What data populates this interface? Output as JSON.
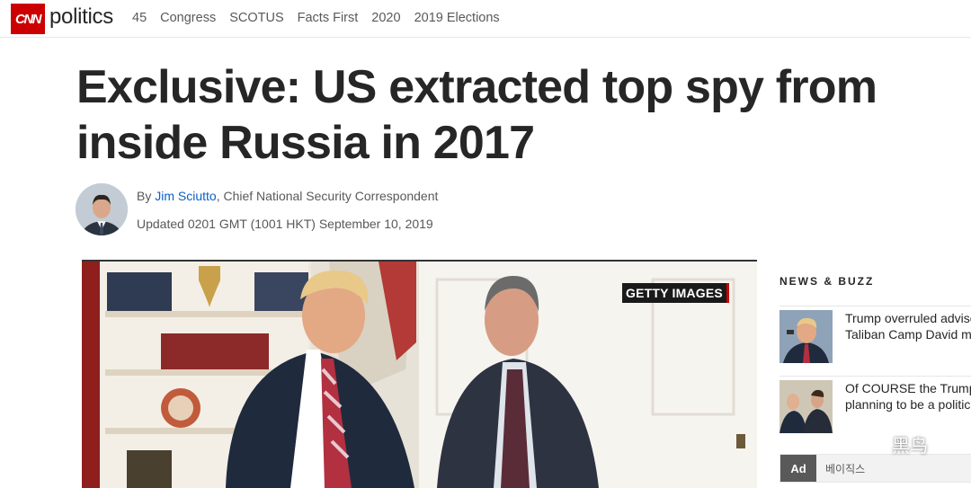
{
  "nav": {
    "logo": "CNN",
    "section": "politics",
    "links": [
      "45",
      "Congress",
      "SCOTUS",
      "Facts First",
      "2020",
      "2019 Elections"
    ]
  },
  "article": {
    "headline": "Exclusive: US extracted top spy from inside Russia in 2017",
    "byline_prefix": "By ",
    "author": "Jim Sciutto",
    "author_title": ", Chief National Security Correspondent",
    "updated": "Updated 0201 GMT (1001 HKT) September 10, 2019",
    "photo_credit": "GETTY IMAGES"
  },
  "sidebar": {
    "title": "NEWS & BUZZ",
    "items": [
      {
        "text_line1": "Trump overruled advise",
        "text_line2": "Taliban Camp David me"
      },
      {
        "text_line1": "Of COURSE the Trumps",
        "text_line2": "planning to be a politic"
      }
    ],
    "ad_label": "Ad",
    "ad_text": "베이직스"
  },
  "watermark": "黑鸟",
  "colors": {
    "brand": "#cc0000",
    "link": "#0c5ec8"
  }
}
